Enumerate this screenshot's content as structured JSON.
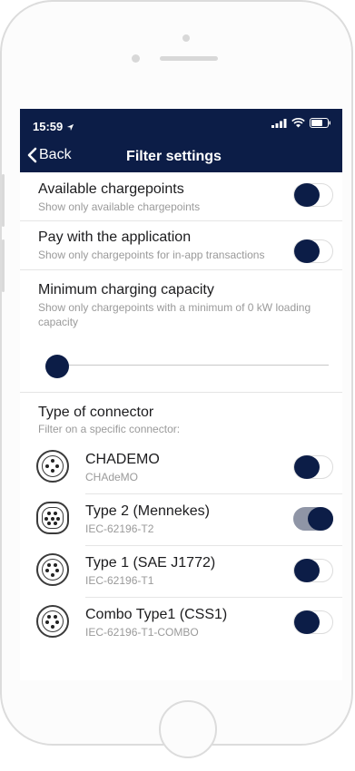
{
  "status_bar": {
    "time": "15:59"
  },
  "nav": {
    "back_label": "Back",
    "title": "Filter settings"
  },
  "settings": [
    {
      "title": "Available chargepoints",
      "subtitle": "Show only available chargepoints",
      "enabled": false
    },
    {
      "title": "Pay with the application",
      "subtitle": "Show only chargepoints for in-app transactions",
      "enabled": false
    }
  ],
  "capacity": {
    "title": "Minimum charging capacity",
    "subtitle": "Show only chargepoints with a minimum of 0 kW loading capacity",
    "value_kw": 0
  },
  "connector_section": {
    "title": "Type of connector",
    "subtitle": "Filter on a specific connector:"
  },
  "connectors": [
    {
      "name": "CHADEMO",
      "code": "CHAdeMO",
      "enabled": false,
      "icon": "chademo-plug-icon"
    },
    {
      "name": "Type 2 (Mennekes)",
      "code": "IEC-62196-T2",
      "enabled": true,
      "icon": "type2-plug-icon"
    },
    {
      "name": "Type 1 (SAE J1772)",
      "code": "IEC-62196-T1",
      "enabled": false,
      "icon": "type1-plug-icon"
    },
    {
      "name": "Combo Type1 (CSS1)",
      "code": "IEC-62196-T1-COMBO",
      "enabled": false,
      "icon": "combo-type1-plug-icon"
    }
  ],
  "colors": {
    "navbar": "#0c1d47",
    "toggle_on_track": "#8f95a6",
    "knob": "#0c1d47"
  }
}
